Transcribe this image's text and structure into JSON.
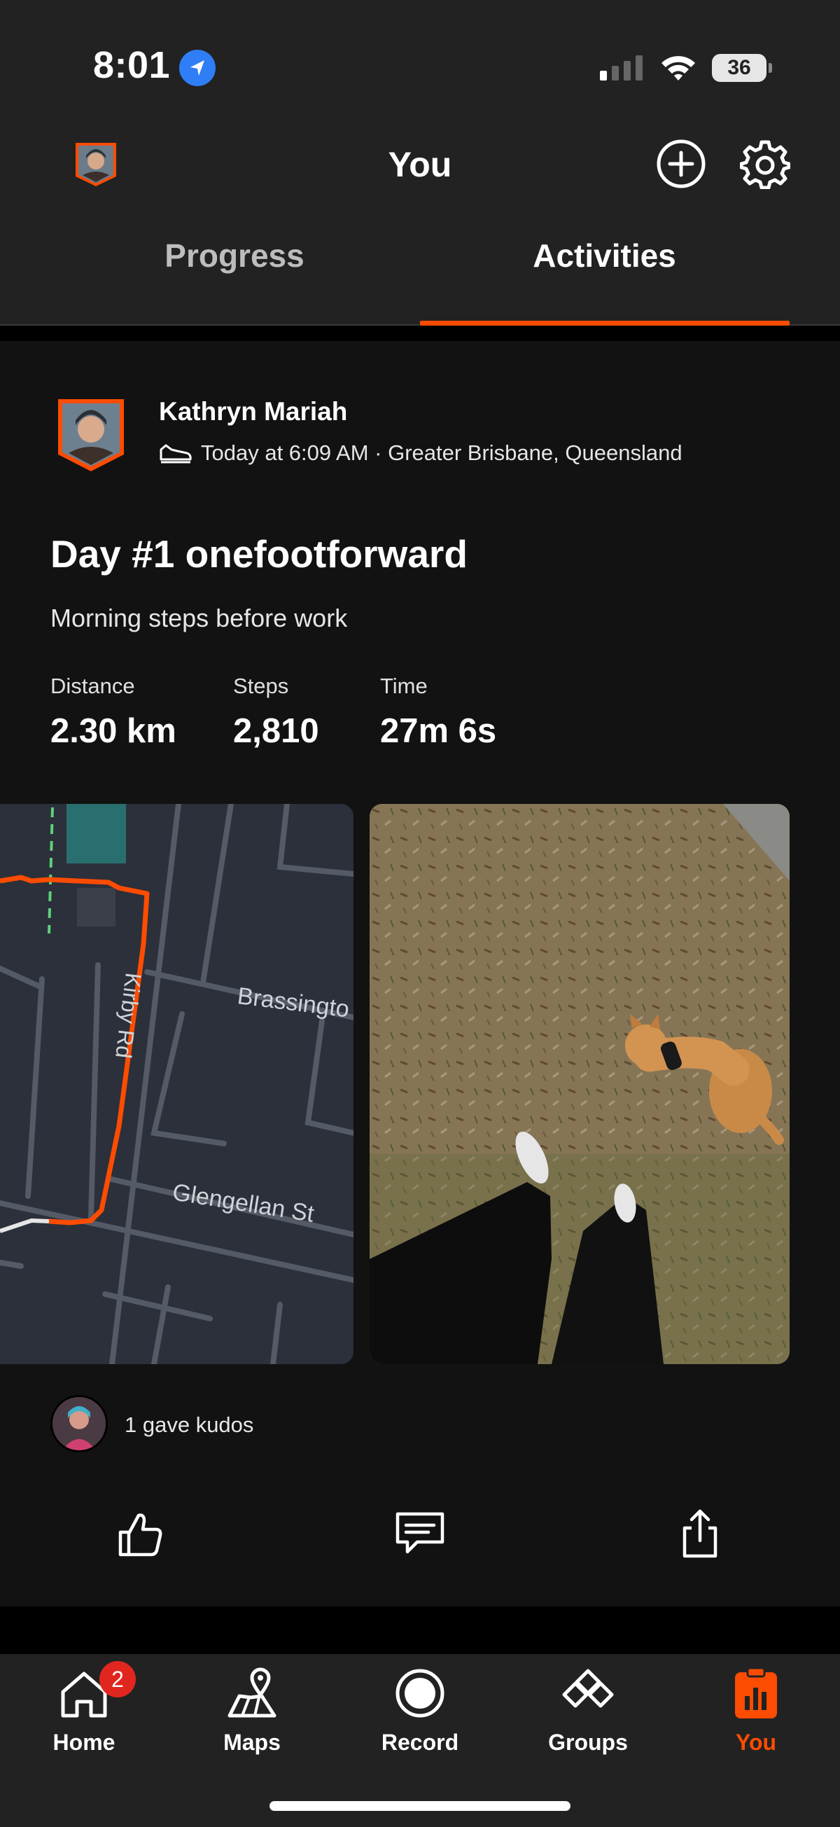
{
  "status_bar": {
    "time": "8:01",
    "battery": "36"
  },
  "header": {
    "title": "You"
  },
  "tabs": [
    {
      "label": "Progress",
      "active": false
    },
    {
      "label": "Activities",
      "active": true
    }
  ],
  "activity": {
    "athlete_name": "Kathryn Mariah",
    "meta": "Today at 6:09 AM · Greater Brisbane, Queensland",
    "title": "Day #1 onefootforward",
    "description": "Morning steps before work",
    "stats": [
      {
        "label": "Distance",
        "value": "2.30 km"
      },
      {
        "label": "Steps",
        "value": "2,810"
      },
      {
        "label": "Time",
        "value": "27m 6s"
      }
    ],
    "map_labels": {
      "street1": "Brassingto",
      "street2": "Glengellan St",
      "street3": "Kirby Rd"
    },
    "kudos_text": "1 gave kudos"
  },
  "nav": {
    "items": [
      {
        "label": "Home",
        "badge": "2"
      },
      {
        "label": "Maps"
      },
      {
        "label": "Record"
      },
      {
        "label": "Groups"
      },
      {
        "label": "You",
        "active": true
      }
    ]
  },
  "colors": {
    "accent": "#fc4c02",
    "background": "#222222",
    "card": "#121212",
    "badge": "#e0261e"
  }
}
